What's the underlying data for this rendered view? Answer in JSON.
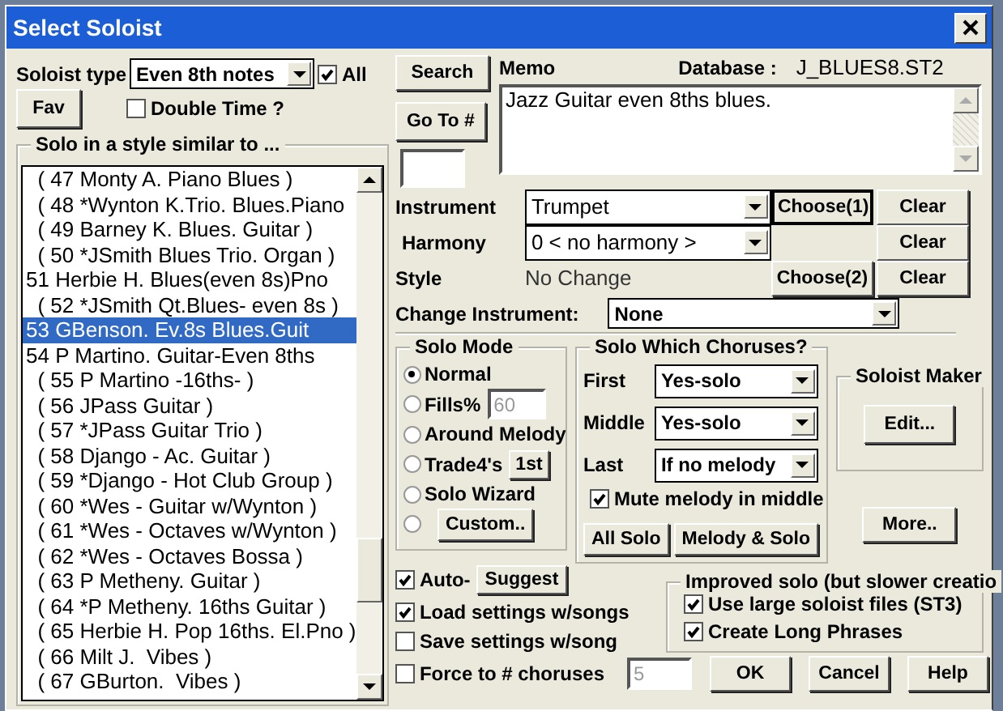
{
  "window": {
    "title": "Select Soloist"
  },
  "soloist_type": {
    "label": "Soloist type",
    "value": "Even 8th notes"
  },
  "all": {
    "label": "All",
    "checked": true
  },
  "fav_button": "Fav",
  "double_time": {
    "label": "Double Time ?",
    "checked": false
  },
  "list_group": "Solo in a style similar to ...",
  "list": [
    {
      "text": "  ( 47 Monty A. Piano Blues )",
      "selected": false
    },
    {
      "text": "  ( 48 *Wynton K.Trio. Blues.Piano",
      "selected": false
    },
    {
      "text": "  ( 49 Barney K. Blues. Guitar )",
      "selected": false
    },
    {
      "text": "  ( 50 *JSmith Blues Trio. Organ )",
      "selected": false
    },
    {
      "text": "51 Herbie H. Blues(even 8s)Pno",
      "selected": false
    },
    {
      "text": "  ( 52 *JSmith Qt.Blues- even 8s )",
      "selected": false
    },
    {
      "text": "53 GBenson. Ev.8s Blues.Guit",
      "selected": true
    },
    {
      "text": "54 P Martino. Guitar-Even 8ths",
      "selected": false
    },
    {
      "text": "  ( 55 P Martino -16ths- )",
      "selected": false
    },
    {
      "text": "  ( 56 JPass Guitar )",
      "selected": false
    },
    {
      "text": "  ( 57 *JPass Guitar Trio )",
      "selected": false
    },
    {
      "text": "  ( 58 Django - Ac. Guitar )",
      "selected": false
    },
    {
      "text": "  ( 59 *Django - Hot Club Group )",
      "selected": false
    },
    {
      "text": "  ( 60 *Wes - Guitar w/Wynton )",
      "selected": false
    },
    {
      "text": "  ( 61 *Wes - Octaves w/Wynton )",
      "selected": false
    },
    {
      "text": "  ( 62 *Wes - Octaves Bossa )",
      "selected": false
    },
    {
      "text": "  ( 63 P Metheny. Guitar )",
      "selected": false
    },
    {
      "text": "  ( 64 *P Metheny. 16ths Guitar )",
      "selected": false
    },
    {
      "text": "  ( 65 Herbie H. Pop 16ths. El.Pno )",
      "selected": false
    },
    {
      "text": "  ( 66 Milt J.  Vibes )",
      "selected": false
    },
    {
      "text": "  ( 67 GBurton.  Vibes )",
      "selected": false
    }
  ],
  "search_button": "Search",
  "goto_button": "Go To #",
  "memo": {
    "label": "Memo",
    "value": "Jazz Guitar even 8ths blues."
  },
  "database": {
    "label": "Database :",
    "value": "J_BLUES8.ST2"
  },
  "instrument": {
    "label": "Instrument",
    "value": "Trumpet"
  },
  "harmony": {
    "label": "Harmony",
    "value": "0 < no harmony >"
  },
  "style": {
    "label": "Style",
    "value": "No Change"
  },
  "choose1": "Choose(1)",
  "choose2": "Choose(2)",
  "clear_buttons": [
    "Clear",
    "Clear",
    "Clear"
  ],
  "change_instrument": {
    "label": "Change Instrument:",
    "value": "None"
  },
  "solo_mode": {
    "title": "Solo Mode",
    "options": [
      {
        "label": "Normal",
        "selected": true,
        "kind": "plain"
      },
      {
        "label": "Fills%",
        "selected": false,
        "kind": "input",
        "value": "60"
      },
      {
        "label": "Around Melody",
        "selected": false,
        "kind": "plain"
      },
      {
        "label": "Trade4's",
        "selected": false,
        "kind": "button",
        "button": "1st"
      },
      {
        "label": "Solo Wizard",
        "selected": false,
        "kind": "plain"
      },
      {
        "selected": false,
        "kind": "custom",
        "button": "Custom.."
      }
    ]
  },
  "choruses": {
    "title": "Solo Which Choruses?",
    "rows": [
      {
        "label": "First",
        "value": "Yes-solo"
      },
      {
        "label": "Middle",
        "value": "Yes-solo"
      },
      {
        "label": "Last",
        "value": "If no melody"
      }
    ],
    "mute": {
      "label": "Mute melody in middle",
      "checked": true
    },
    "buttons": [
      "All Solo",
      "Melody & Solo"
    ]
  },
  "soloist_maker": {
    "title": "Soloist Maker",
    "button": "Edit..."
  },
  "more_button": "More..",
  "auto": {
    "label": "Auto-",
    "checked": true
  },
  "suggest_button": "Suggest",
  "load_settings": {
    "label": "Load settings w/songs",
    "checked": true
  },
  "save_settings": {
    "label": "Save settings w/song",
    "checked": false
  },
  "improved": {
    "title": "Improved solo (but slower creatio",
    "options": [
      {
        "label": "Use large soloist files (ST3)",
        "checked": true
      },
      {
        "label": "Create Long Phrases",
        "checked": true
      }
    ]
  },
  "force": {
    "label": "Force to # choruses",
    "checked": false,
    "value": "5"
  },
  "dialog_buttons": [
    "OK",
    "Cancel",
    "Help"
  ]
}
